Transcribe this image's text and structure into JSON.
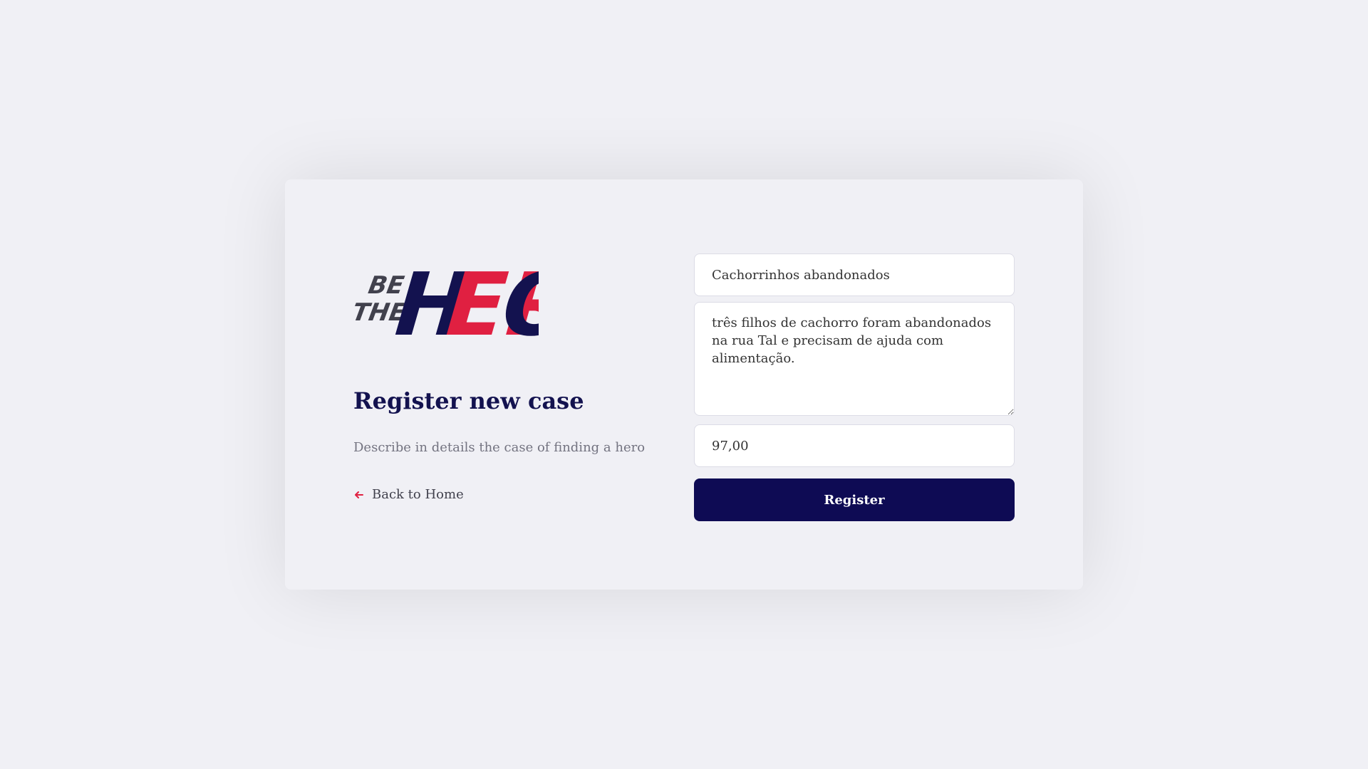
{
  "logo": {
    "line1": "BE",
    "line2": "THE",
    "brand": "HERO",
    "colors": {
      "navy": "#13124f",
      "red": "#e02041",
      "gray": "#41414d"
    }
  },
  "header": {
    "title": "Register new case",
    "description": "Describe in details the case of finding a hero"
  },
  "nav": {
    "back_label": "Back to Home",
    "back_icon": "arrow-left-icon"
  },
  "form": {
    "title_value": "Cachorrinhos abandonados",
    "description_value": "três filhos de cachorro foram abandonados na rua Tal e precisam de ajuda com alimentação.",
    "value_value": "97,00",
    "submit_label": "Register"
  },
  "theme": {
    "background": "#f0f0f5",
    "primary": "#0e0b54",
    "accent": "#e02041",
    "text_muted": "#737380"
  }
}
